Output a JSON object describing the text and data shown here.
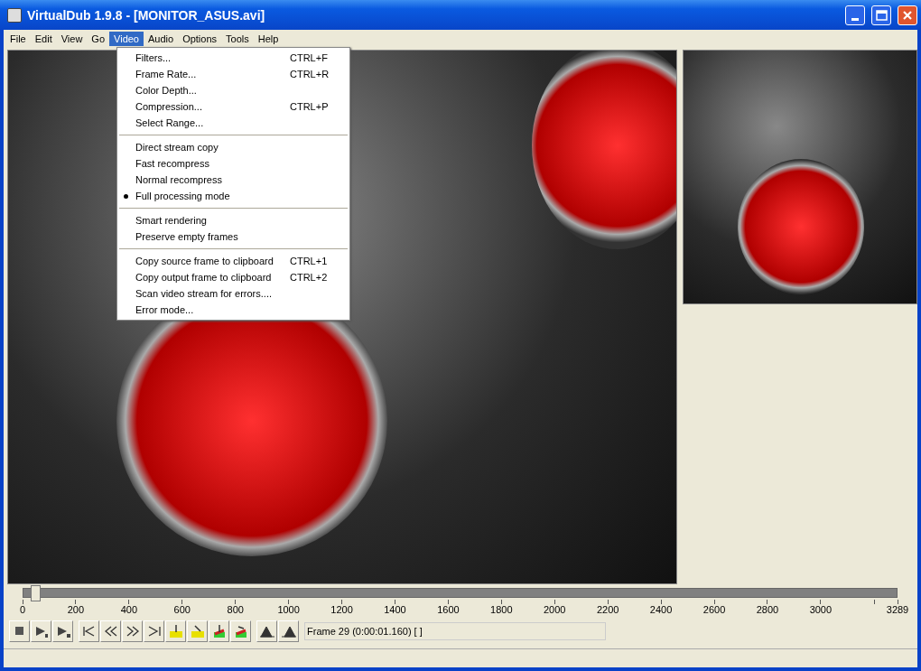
{
  "window": {
    "title": "VirtualDub 1.9.8 - [MONITOR_ASUS.avi]"
  },
  "menu_bar": [
    {
      "label": "File",
      "selected": false
    },
    {
      "label": "Edit",
      "selected": false
    },
    {
      "label": "View",
      "selected": false
    },
    {
      "label": "Go",
      "selected": false
    },
    {
      "label": "Video",
      "selected": true
    },
    {
      "label": "Audio",
      "selected": false
    },
    {
      "label": "Options",
      "selected": false
    },
    {
      "label": "Tools",
      "selected": false
    },
    {
      "label": "Help",
      "selected": false
    }
  ],
  "video_menu": [
    {
      "kind": "item",
      "label": "Filters...",
      "shortcut": "CTRL+F",
      "checked": false
    },
    {
      "kind": "item",
      "label": "Frame Rate...",
      "shortcut": "CTRL+R",
      "checked": false
    },
    {
      "kind": "item",
      "label": "Color Depth...",
      "checked": false
    },
    {
      "kind": "item",
      "label": "Compression...",
      "shortcut": "CTRL+P",
      "checked": false
    },
    {
      "kind": "item",
      "label": "Select Range...",
      "checked": false
    },
    {
      "kind": "separator"
    },
    {
      "kind": "item",
      "label": "Direct stream copy",
      "checked": false
    },
    {
      "kind": "item",
      "label": "Fast recompress",
      "checked": false
    },
    {
      "kind": "item",
      "label": "Normal recompress",
      "checked": false
    },
    {
      "kind": "item",
      "label": "Full processing mode",
      "checked": true
    },
    {
      "kind": "separator"
    },
    {
      "kind": "item",
      "label": "Smart rendering",
      "checked": false
    },
    {
      "kind": "item",
      "label": "Preserve empty frames",
      "checked": false
    },
    {
      "kind": "separator"
    },
    {
      "kind": "item",
      "label": "Copy source frame to clipboard",
      "shortcut": "CTRL+1",
      "checked": false
    },
    {
      "kind": "item",
      "label": "Copy output frame to clipboard",
      "shortcut": "CTRL+2",
      "checked": false
    },
    {
      "kind": "item",
      "label": "Scan video stream for errors....",
      "checked": false
    },
    {
      "kind": "item",
      "label": "Error mode...",
      "checked": false
    }
  ],
  "timeline": {
    "level": 0.009,
    "ticks": [
      "0",
      "200",
      "400",
      "600",
      "800",
      "1000",
      "1200",
      "1400",
      "1600",
      "1800",
      "2000",
      "2200",
      "2400",
      "2600",
      "2800",
      "3000",
      "3289"
    ]
  },
  "frame_field": {
    "value": "Frame 29 (0:00:01.160) [ ]"
  }
}
